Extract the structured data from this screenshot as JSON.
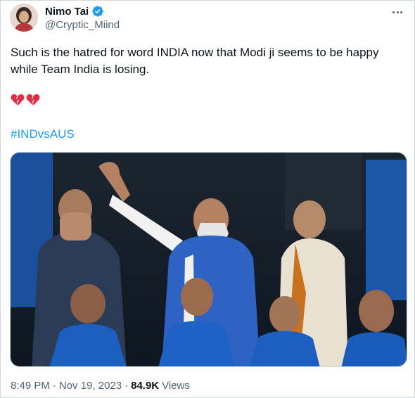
{
  "author": {
    "display_name": "Nimo Tai",
    "handle": "@Cryptic_Miind",
    "verified": true
  },
  "tweet": {
    "text": "Such is the hatred for word INDIA now that Modi ji seems to be happy while Team India is losing.",
    "emoji": "💔💔",
    "hashtag": "#INDvsAUS"
  },
  "meta": {
    "time": "8:49 PM",
    "separator": "·",
    "date": "Nov 19, 2023",
    "views_count": "84.9K",
    "views_label": "Views"
  },
  "colors": {
    "link": "#1d9bf0",
    "verified": "#1d9bf0",
    "secondary_text": "#536471"
  }
}
